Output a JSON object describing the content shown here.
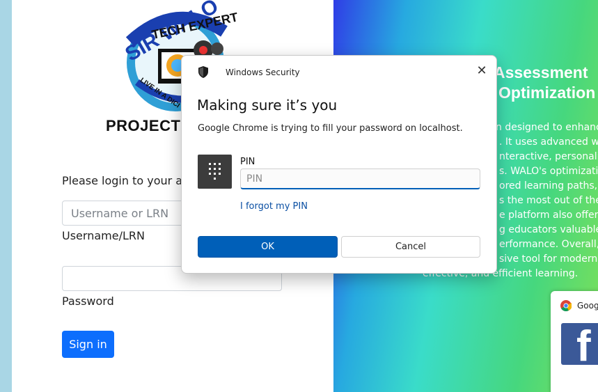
{
  "login": {
    "logo_lines": [
      "SIR WALO",
      "TECH EXPERT",
      "LIVE IN A DICI"
    ],
    "project_title": "PROJECT",
    "prompt": "Please login to your acc",
    "username_placeholder": "Username or LRN",
    "username_label": "Username/LRN",
    "password_value": "",
    "password_label": "Password",
    "signin_label": "Sign in"
  },
  "info": {
    "heading_lines": [
      "Assessment",
      "Optimization"
    ],
    "description_lines": [
      "n designed to enhance",
      ". It uses advanced web",
      "nteractive, personalize",
      "s. WALO's optimization",
      "ored learning paths,",
      "s the most out of their",
      "e platform also offers",
      "g educators valuable",
      "erformance. Overall,",
      "sive tool for modern,",
      "effective, and efficient learning."
    ]
  },
  "google_card": {
    "title": "Goog",
    "tile_letter": "f"
  },
  "dialog": {
    "app_name": "Windows Security",
    "close_glyph": "✕",
    "title": "Making sure it’s you",
    "message": "Google Chrome is trying to fill your password on localhost.",
    "pin_label": "PIN",
    "pin_placeholder": "PIN",
    "forgot_link": "I forgot my PIN",
    "ok_label": "OK",
    "cancel_label": "Cancel"
  },
  "colors": {
    "primary_button": "#0d6efd",
    "dialog_accent": "#005fb8",
    "facebook_blue": "#3b5998"
  },
  "icons": [
    "shield-icon",
    "pin-keypad-icon",
    "chrome-icon",
    "facebook-icon",
    "close-icon"
  ]
}
